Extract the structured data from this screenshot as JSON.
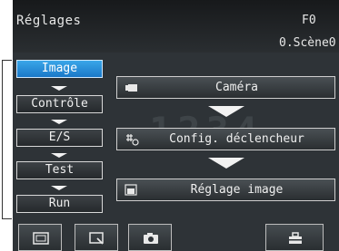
{
  "header": {
    "title": "Réglages",
    "right_code": "F0",
    "scene": "0.Scène0"
  },
  "background_text": "1234",
  "menu": {
    "items": [
      {
        "label": "Image",
        "active": true
      },
      {
        "label": "Contrôle",
        "active": false
      },
      {
        "label": "E/S",
        "active": false
      },
      {
        "label": "Test",
        "active": false
      },
      {
        "label": "Run",
        "active": false
      }
    ]
  },
  "workflow": {
    "steps": [
      {
        "label": "Caméra",
        "icon": "camera-icon"
      },
      {
        "label": "Config. déclencheur",
        "icon": "trigger-icon"
      },
      {
        "label": "Réglage image",
        "icon": "image-adjust-icon"
      }
    ]
  },
  "bottom_bar": {
    "buttons": [
      "display-frame-icon",
      "zoom-window-icon",
      "camera-snapshot-icon",
      "tools-icon"
    ]
  },
  "colors": {
    "accent": "#2b8fd8",
    "background": "#2e3337",
    "text": "#f0f0f0"
  }
}
